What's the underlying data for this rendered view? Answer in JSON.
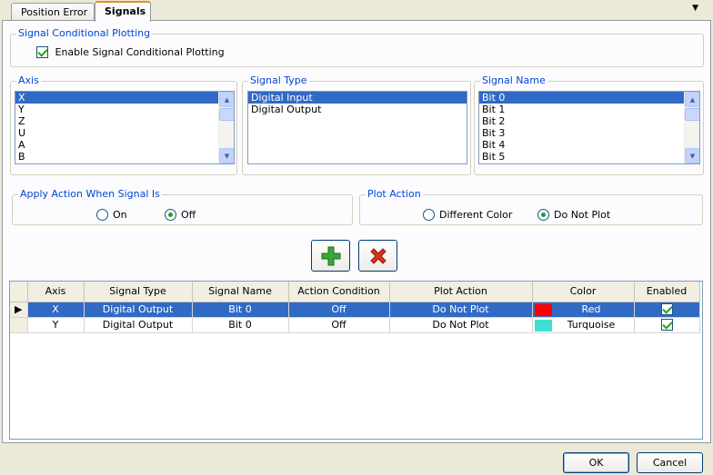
{
  "tabs": [
    {
      "label": "Position Error",
      "active": false
    },
    {
      "label": "Signals",
      "active": true
    }
  ],
  "conditional": {
    "group_label": "Signal Conditional Plotting",
    "enable_label": "Enable Signal Conditional Plotting",
    "enabled": true
  },
  "axis": {
    "label": "Axis",
    "items": [
      "X",
      "Y",
      "Z",
      "U",
      "A",
      "B"
    ],
    "selected": "X"
  },
  "signal_type": {
    "label": "Signal Type",
    "items": [
      "Digital Input",
      "Digital Output"
    ],
    "selected": "Digital Input"
  },
  "signal_name": {
    "label": "Signal Name",
    "items": [
      "Bit 0",
      "Bit 1",
      "Bit 2",
      "Bit 3",
      "Bit 4",
      "Bit 5"
    ],
    "selected": "Bit 0"
  },
  "apply_action": {
    "label": "Apply Action When Signal Is",
    "on_label": "On",
    "off_label": "Off",
    "selected": "Off"
  },
  "plot_action": {
    "label": "Plot Action",
    "different_label": "Different Color",
    "noplot_label": "Do Not Plot",
    "selected": "Do Not Plot"
  },
  "grid": {
    "columns": [
      "Axis",
      "Signal Type",
      "Signal Name",
      "Action Condition",
      "Plot Action",
      "Color",
      "Enabled"
    ],
    "rows": [
      {
        "axis": "X",
        "signal_type": "Digital Output",
        "signal_name": "Bit 0",
        "condition": "Off",
        "plot_action": "Do Not Plot",
        "color_name": "Red",
        "color_hex": "#ff0000",
        "enabled": true,
        "selected": true
      },
      {
        "axis": "Y",
        "signal_type": "Digital Output",
        "signal_name": "Bit 0",
        "condition": "Off",
        "plot_action": "Do Not Plot",
        "color_name": "Turquoise",
        "color_hex": "#40e0d0",
        "enabled": true,
        "selected": false
      }
    ]
  },
  "buttons": {
    "ok": "OK",
    "cancel": "Cancel"
  },
  "colors": {
    "selection": "#316ac5",
    "legend": "#0046d5",
    "add_icon": "#3aa53a",
    "remove_icon": "#e0301e"
  },
  "icons": {
    "add": "plus-icon",
    "remove": "x-icon",
    "current_row": "row-pointer-icon"
  }
}
